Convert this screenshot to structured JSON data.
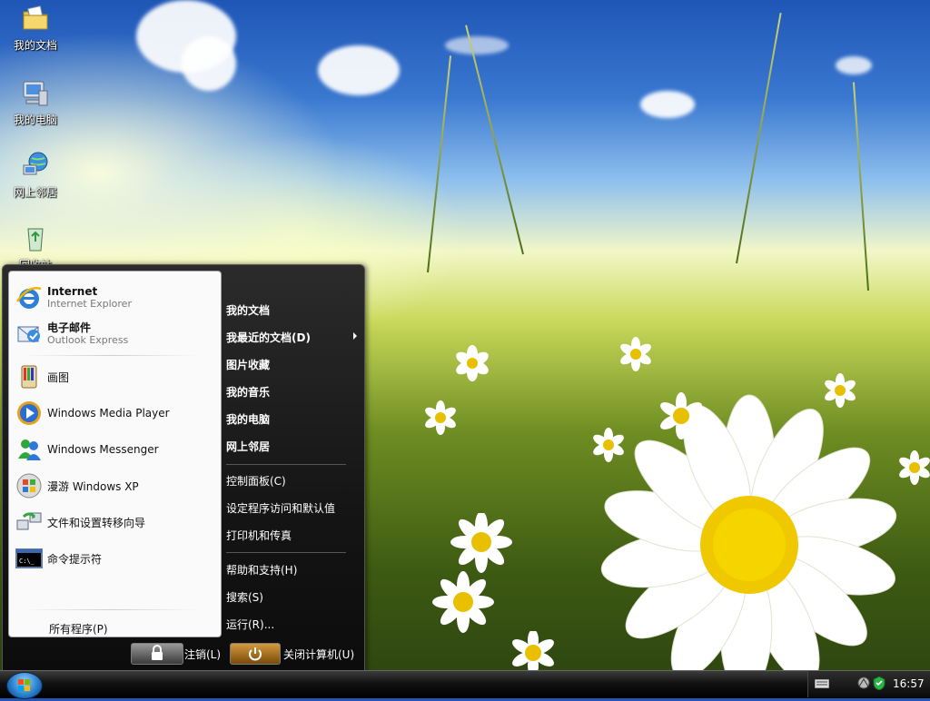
{
  "desktop": {
    "icons": [
      {
        "label": "我的文档",
        "icon": "folder-documents-icon"
      },
      {
        "label": "我的电脑",
        "icon": "my-computer-icon"
      },
      {
        "label": "网上邻居",
        "icon": "network-places-icon"
      },
      {
        "label": "回收站",
        "icon": "recycle-bin-icon"
      }
    ]
  },
  "start_menu": {
    "pinned": [
      {
        "title": "Internet",
        "subtitle": "Internet Explorer",
        "icon": "internet-explorer-icon"
      },
      {
        "title": "电子邮件",
        "subtitle": "Outlook Express",
        "icon": "outlook-express-icon"
      }
    ],
    "recent": [
      {
        "label": "画图",
        "icon": "paint-icon"
      },
      {
        "label": "Windows Media Player",
        "icon": "media-player-icon"
      },
      {
        "label": "Windows Messenger",
        "icon": "messenger-icon"
      },
      {
        "label": "漫游 Windows XP",
        "icon": "tour-xp-icon"
      },
      {
        "label": "文件和设置转移向导",
        "icon": "transfer-wizard-icon"
      },
      {
        "label": "命令提示符",
        "icon": "command-prompt-icon"
      }
    ],
    "all_programs": "所有程序(P)",
    "places": [
      "我的文档",
      "我最近的文档(D)",
      "图片收藏",
      "我的音乐",
      "我的电脑",
      "网上邻居"
    ],
    "system": [
      "控制面板(C)",
      "设定程序访问和默认值",
      "打印机和传真"
    ],
    "help": [
      "帮助和支持(H)",
      "搜索(S)",
      "运行(R)..."
    ],
    "logoff_label": "注销(L)",
    "shutdown_label": "关闭计算机(U)"
  },
  "taskbar": {
    "clock": "16:57"
  },
  "colors": {
    "menu_dark": "#151515",
    "left_pane": "#fafafa",
    "shutdown_orange": "#d49a3b",
    "start_orb_blue": "#2479c7"
  }
}
